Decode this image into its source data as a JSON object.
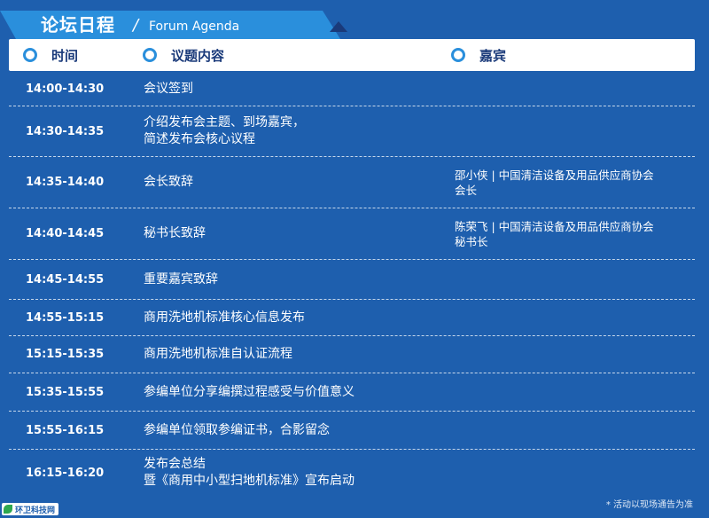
{
  "title": {
    "main": "论坛日程",
    "separator": "/",
    "english": "Forum Agenda"
  },
  "header": {
    "time": "时间",
    "topic": "议题内容",
    "guest": "嘉宾"
  },
  "rows": [
    {
      "time": "14:00-14:30",
      "topic": [
        "会议签到"
      ],
      "guest": []
    },
    {
      "time": "14:30-14:35",
      "topic": [
        "介绍发布会主题、到场嘉宾，",
        "简述发布会核心议程"
      ],
      "guest": []
    },
    {
      "time": "14:35-14:40",
      "topic": [
        "会长致辞"
      ],
      "guest": [
        "邵小侠 | 中国清洁设备及用品供应商协会",
        "会长"
      ]
    },
    {
      "time": "14:40-14:45",
      "topic": [
        "秘书长致辞"
      ],
      "guest": [
        "陈荣飞 | 中国清洁设备及用品供应商协会",
        "秘书长"
      ]
    },
    {
      "time": "14:45-14:55",
      "topic": [
        "重要嘉宾致辞"
      ],
      "guest": []
    },
    {
      "time": "14:55-15:15",
      "topic": [
        "商用洗地机标准核心信息发布"
      ],
      "guest": []
    },
    {
      "time": "15:15-15:35",
      "topic": [
        "商用洗地机标准自认证流程"
      ],
      "guest": []
    },
    {
      "time": "15:35-15:55",
      "topic": [
        "参编单位分享编撰过程感受与价值意义"
      ],
      "guest": []
    },
    {
      "time": "15:55-16:15",
      "topic": [
        "参编单位领取参编证书，合影留念"
      ],
      "guest": []
    },
    {
      "time": "16:15-16:20",
      "topic": [
        "发布会总结",
        "暨《商用中小型扫地机标准》宣布启动"
      ],
      "guest": []
    }
  ],
  "footnote": "* 活动以现场通告为准",
  "logo_text": "环卫科技网",
  "colors": {
    "background": "#1e5fae",
    "accent": "#2a8fdc",
    "header_text": "#1a3a7a"
  }
}
